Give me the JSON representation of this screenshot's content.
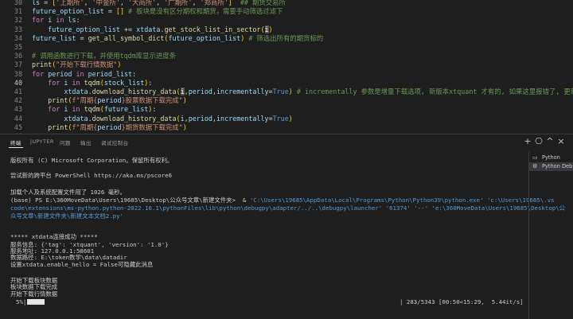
{
  "editor": {
    "lines": [
      {
        "n": "30",
        "html": "<span class='var'>ls</span> <span class='op'>=</span> <span class='brk'>[</span><span class='str'>'上期所'</span>, <span class='str'>'中金所'</span>, <span class='str'>'大商所'</span>, <span class='str'>'广期所'</span>, <span class='str'>'郑商所'</span><span class='brk'>]</span>  <span class='cmt'>## 期货交易所</span>"
      },
      {
        "n": "31",
        "html": "<span class='var'>future_option_list</span> <span class='op'>=</span> <span class='brk'>[]</span> <span class='cmt'># 板块是没有区分期权和期货，需要手动筛选过滤下</span>"
      },
      {
        "n": "32",
        "html": "<span class='kw'>for</span> <span class='var'>i</span> <span class='kw'>in</span> <span class='var'>ls</span>:"
      },
      {
        "n": "33",
        "html": "    <span class='var'>future_option_list</span> <span class='op'>+=</span> <span class='var'>xtdata</span>.<span class='fn'>get_stock_list_in_sector</span><span class='brk'>(</span><span class='cur'>i</span><span class='brk'>)</span>"
      },
      {
        "n": "34",
        "html": "<span class='var'>future_list</span> <span class='op'>=</span> <span class='fn'>get_all_symbol_dict</span><span class='brk'>(</span><span class='var'>future_option_list</span><span class='brk'>)</span> <span class='cmt'># 筛选出所有的期货标的</span>"
      },
      {
        "n": "35",
        "html": ""
      },
      {
        "n": "36",
        "html": "<span class='cmt'># 调用函数进行下载，并使用tqdm库显示进度条</span>"
      },
      {
        "n": "37",
        "html": "<span class='fn'>print</span><span class='brk'>(</span><span class='str'>\"开始下载行情数据\"</span><span class='brk'>)</span>"
      },
      {
        "n": "38",
        "html": "<span class='kw'>for</span> <span class='var'>period</span> <span class='kw'>in</span> <span class='var'>period_list</span>:"
      },
      {
        "n": "40",
        "active": true,
        "html": "    <span class='kw'>for</span> <span class='var'>i</span> <span class='kw'>in</span> <span class='fn'>tqdm</span><span class='brk'>(</span><span class='var'>stock_list</span><span class='brk'>)</span>:"
      },
      {
        "n": "41",
        "html": "        <span class='var'>xtdata</span>.<span class='fn'>download_history_data</span><span class='brk'>(</span><span class='cur'>i</span>,<span class='var'>period</span>,<span class='var'>incrementally</span><span class='op'>=</span><span class='bool'>True</span><span class='brk'>)</span> <span class='cmt'># incrementally 参数是增量下载选项, 新版本xtquant 才有的, 如果这里报错了, 更新xtqua</span>"
      },
      {
        "n": "42",
        "html": "    <span class='fn'>print</span><span class='brk'>(</span><span class='str'>f\"周期{</span><span class='var'>period</span><span class='str'>}股票数据下载完成\"</span><span class='brk'>)</span>"
      },
      {
        "n": "43",
        "html": "    <span class='kw'>for</span> <span class='var'>i</span> <span class='kw'>in</span> <span class='fn'>tqdm</span><span class='brk'>(</span><span class='var'>future_list</span><span class='brk'>)</span>:"
      },
      {
        "n": "44",
        "html": "        <span class='var'>xtdata</span>.<span class='fn'>download_history_data</span><span class='brk'>(</span><span class='var'>i</span>,<span class='var'>period</span>,<span class='var'>incrementally</span><span class='op'>=</span><span class='bool'>True</span><span class='brk'>)</span>"
      },
      {
        "n": "45",
        "html": "    <span class='fn'>print</span><span class='brk'>(</span><span class='str'>f\"周期{</span><span class='var'>period</span><span class='str'>}期货数据下载完成\"</span><span class='brk'>)</span>"
      },
      {
        "n": "46",
        "html": ""
      }
    ]
  },
  "panel": {
    "tabs": [
      "终端",
      "JUPYTER",
      "问题",
      "输出",
      "调试控制台"
    ],
    "active_tab": 0,
    "actions": {
      "add": "+",
      "split": "⎔",
      "trash": "🗑",
      "more": "…",
      "maximize": "^",
      "close": "×"
    }
  },
  "terminal": {
    "lines": [
      "版权所有 (C) Microsoft Corporation。保留所有权利。",
      "",
      "尝试新的跨平台 PowerShell https://aka.ms/pscore6",
      "",
      "加载个人及系统配置文件用了 1026 毫秒。",
      "(base) PS E:\\360MoveData\\Users\\19685\\Desktop\\公众号文章\\新建文件夹>  & 'C:\\Users\\19685\\AppData\\Local\\Programs\\Python\\Python39\\python.exe' 'c:\\Users\\19685\\.vs",
      "code\\extensions\\ms-python.python-2022.16.1\\pythonFiles\\lib\\python\\debugpy\\adapter/../..\\debugpy\\launcher' '61374' '--' 'e:\\360MoveData\\Users\\19685\\Desktop\\公",
      "众号文章\\新建文件夹\\新建文本文档2.py'",
      "",
      "***** xtdata连接成功 *****",
      "服务信息: {'tag': 'xtquant', 'version': '1.0'}",
      "服务地址: 127.0.0.1:58601",
      "数据路径: E:\\token数学\\data\\datadir",
      "设置xtdata.enable_hello = False可隐藏此消息",
      "",
      "开始下载板块数据",
      "板块数据下载完成",
      "开始下载行情数据"
    ],
    "progress_percent": "5%|",
    "progress_stats": "| 283/5343 [00:50<15:29,  5.44it/s]"
  },
  "term_list": [
    {
      "label": "Python",
      "icon": "▭",
      "selected": false
    },
    {
      "label": "Python Deb...",
      "icon": "⚙",
      "selected": true
    }
  ]
}
